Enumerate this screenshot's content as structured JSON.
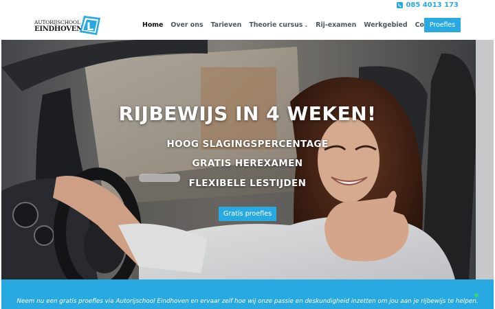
{
  "topbar": {
    "phone": "085 4013 173",
    "phone_icon": "phone-icon"
  },
  "header": {
    "logo": {
      "line1": "AUTORIJSCHOOL",
      "line2": "EINDHOVEN",
      "mark": "L"
    },
    "nav": [
      {
        "label": "Home",
        "active": true
      },
      {
        "label": "Over ons"
      },
      {
        "label": "Tarieven"
      },
      {
        "label": "Theorie cursus",
        "dropdown": true
      },
      {
        "label": "Rij-examen"
      },
      {
        "label": "Werkgebied"
      },
      {
        "label": "Contact"
      }
    ],
    "cta_label": "Proefles"
  },
  "hero": {
    "title": "RIJBEWIJS IN 4 WEKEN!",
    "lines": [
      "HOOG SLAGINGSPERCENTAGE",
      "GRATIS HEREXAMEN",
      "FLEXIBELE LESTIJDEN"
    ],
    "button_label": "Gratis proefles"
  },
  "band": {
    "text": "Neem nu een gratis proefles via Autorijschool Eindhoven en ervaar zelf hoe wij onze passie en deskundigheid inzetten om jou aan je rijbewijs te helpen."
  },
  "colors": {
    "accent": "#29a9e1",
    "nav_text": "#4a5560",
    "nav_active": "#111111",
    "chat": "#3fd16b"
  }
}
